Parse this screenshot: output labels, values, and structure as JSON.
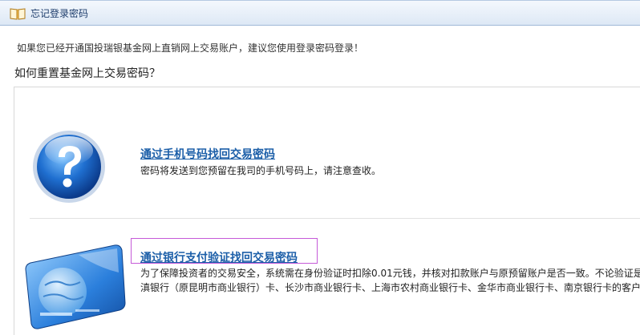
{
  "header": {
    "title": "忘记登录密码",
    "icon": "book-icon"
  },
  "notice": "如果您已经开通国投瑞银基金网上直销网上交易账户，建议您使用登录密码登录！",
  "question": "如何重置基金网上交易密码？",
  "options": [
    {
      "icon": "question-mark-icon",
      "link": "通过手机号码找回交易密码",
      "desc": "密码将发送到您预留在我司的手机号码上，请注意查收。"
    },
    {
      "icon": "bank-card-icon",
      "link": "通过银行支付验证找回交易密码",
      "desc_line1": "为了保障投资者的交易安全，系统需在身份验证时扣除0.01元钱，并核对扣款账户与原预留账户是否一致。不论验证是",
      "desc_line2": "滇银行（原昆明市商业银行）卡、长沙市商业银行卡、上海市农村商业银行卡、金华市商业银行卡、南京银行卡的客户"
    }
  ],
  "colors": {
    "link": "#1b5ea8",
    "highlight": "#c55ad8",
    "titlebar": "#dde8f5"
  }
}
